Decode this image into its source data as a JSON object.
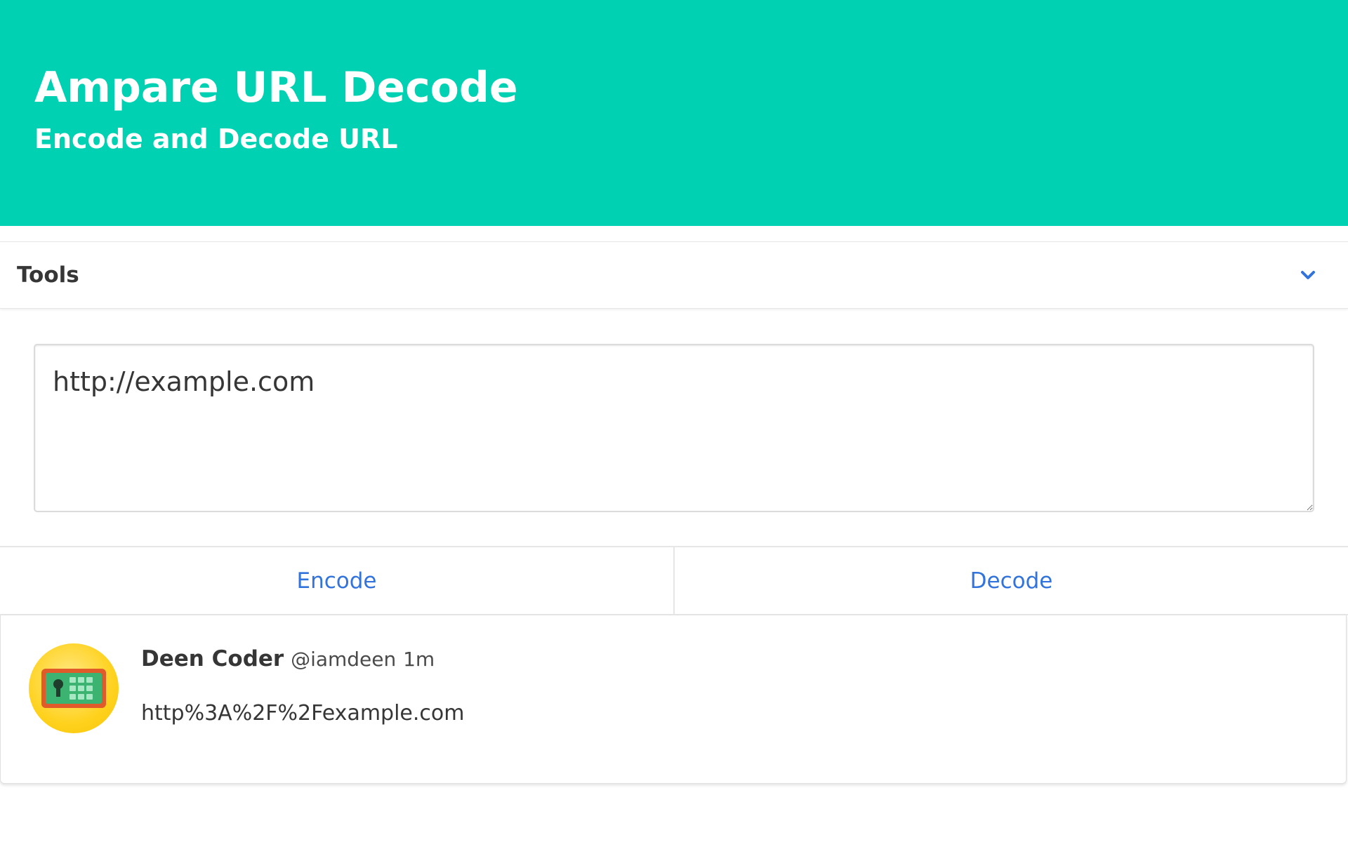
{
  "hero": {
    "title": "Ampare URL Decode",
    "subtitle": "Encode and Decode URL",
    "background_color": "#00d1b2"
  },
  "tools": {
    "label": "Tools",
    "toggle_icon": "chevron-down-icon"
  },
  "editor": {
    "value": "http://example.com"
  },
  "actions": {
    "encode_label": "Encode",
    "decode_label": "Decode",
    "link_color": "#3273dc"
  },
  "result": {
    "author_name": "Deen Coder",
    "author_handle": "@iamdeen",
    "time": "1m",
    "avatar_icon": "safe-keypad-icon",
    "text": "http%3A%2F%2Fexample.com"
  }
}
